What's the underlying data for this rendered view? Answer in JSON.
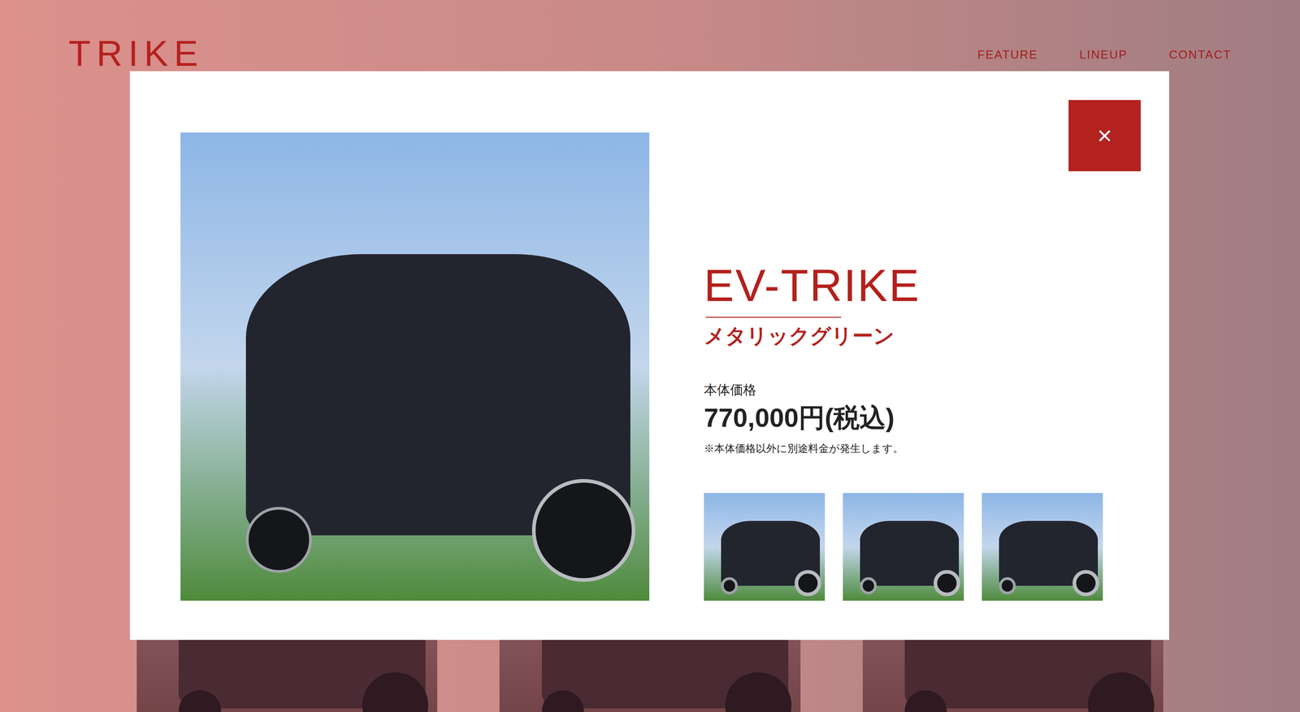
{
  "header": {
    "logo": "TRIKE",
    "nav": [
      {
        "label": "FEATURE"
      },
      {
        "label": "LINEUP"
      },
      {
        "label": "CONTACT"
      }
    ]
  },
  "lineup": {
    "cards": [
      {},
      {},
      {}
    ]
  },
  "modal": {
    "close": "×",
    "title": "EV-TRIKE",
    "color_name": "メタリックグリーン",
    "price_label": "本体価格",
    "price": "770,000円(税込)",
    "note": "※本体価格以外に別途料金が発生します。",
    "thumbnails": [
      {},
      {},
      {}
    ]
  }
}
